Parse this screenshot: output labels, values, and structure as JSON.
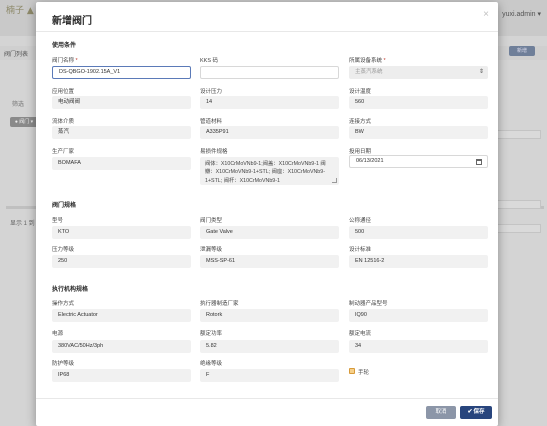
{
  "background": {
    "logo": "楠子 ▲",
    "user": "yuxi.admin ▾",
    "nav_item": "阀门列表",
    "right_btn": "新增",
    "filter_label": "筛选",
    "pill": "● 阀门 ▾",
    "pager": "显示 1 到 10"
  },
  "modal": {
    "title": "新增阀门",
    "close": "×"
  },
  "sections": {
    "basic": "使用条件",
    "valve": "阀门规格",
    "actuator": "执行机构规格"
  },
  "basic": {
    "valve_name": {
      "label": "阀门名称",
      "value": "DS-QBGO-1902.15A_V1"
    },
    "kks": {
      "label": "KKS 码",
      "value": ""
    },
    "system": {
      "label": "所属设备系统",
      "value": "主蒸汽系统"
    },
    "location": {
      "label": "应用位置",
      "value": "电动阀阀"
    },
    "design_pressure": {
      "label": "设计压力",
      "value": "14"
    },
    "design_temp": {
      "label": "设计温度",
      "value": "560"
    },
    "medium": {
      "label": "流体介质",
      "value": "蒸汽"
    },
    "pipe_material": {
      "label": "管道材料",
      "value": "A335P91"
    },
    "connection": {
      "label": "连接方式",
      "value": "BW"
    },
    "manufacturer": {
      "label": "生产厂家",
      "value": "BOMAFA"
    },
    "parts_spec": {
      "label": "易损件规格",
      "value": "阀体：X10CrMoVNb9-1;阀盖：X10CrMoVNb9-1 阀瓣：X10CrMoVNb9-1+STL; 阀座：X10CrMoVNb9-1+STL; 阀杆：X10CrMoVNb9-1"
    },
    "install_date": {
      "label": "投用日期",
      "value": "06/13/2021"
    }
  },
  "valve": {
    "model": {
      "label": "型号",
      "value": "KTO"
    },
    "type": {
      "label": "阀门类型",
      "value": "Gate Valve"
    },
    "nominal_dia": {
      "label": "公称通径",
      "value": "500"
    },
    "pressure_class": {
      "label": "压力等级",
      "value": "250"
    },
    "tightness": {
      "label": "泄漏等级",
      "value": "MSS-SP-61"
    },
    "design_std": {
      "label": "设计标准",
      "value": "EN 12516-2"
    }
  },
  "actuator": {
    "operation": {
      "label": "操作方式",
      "value": "Electric Actuator"
    },
    "act_maker": {
      "label": "执行器制造厂家",
      "value": "Rotork"
    },
    "act_model": {
      "label": "制动器产品型号",
      "value": "IQ90"
    },
    "power": {
      "label": "电源",
      "value": "380VAC/50Hz/3ph"
    },
    "rated_power": {
      "label": "额定功率",
      "value": "5.82"
    },
    "rated_current": {
      "label": "额定电流",
      "value": "34"
    },
    "protection": {
      "label": "防护等级",
      "value": "IP68"
    },
    "insulation": {
      "label": "绝缘等级",
      "value": "F"
    },
    "manual_label": "手轮"
  },
  "buttons": {
    "cancel": "取消",
    "save": "保存"
  },
  "colors": {
    "save_button": "#28457d",
    "cancel_button": "#8c96a8",
    "active_border": "#5b7ab8",
    "checkbox": "#f6d08a"
  }
}
